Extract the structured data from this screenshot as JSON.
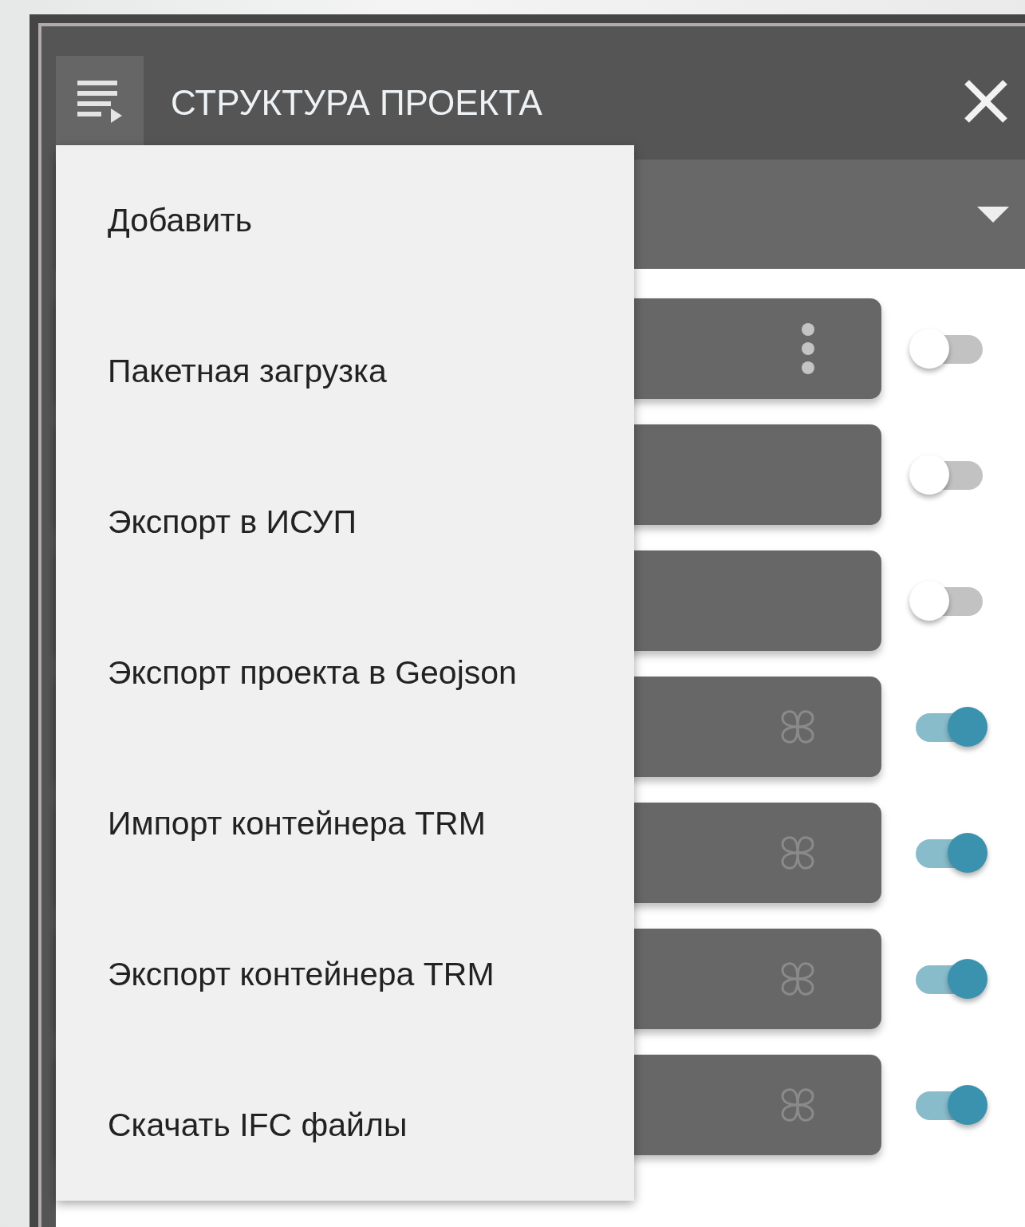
{
  "header": {
    "title": "СТРУКТУРА ПРОЕКТА"
  },
  "menu": {
    "items": [
      {
        "label": "Добавить"
      },
      {
        "label": "Пакетная загрузка"
      },
      {
        "label": "Экспорт в ИСУП"
      },
      {
        "label": "Экспорт проекта в Geojson"
      },
      {
        "label": "Импорт контейнера TRM"
      },
      {
        "label": "Экспорт контейнера TRM"
      },
      {
        "label": "Скачать IFC файлы"
      }
    ]
  },
  "layers": [
    {
      "kind": "dots",
      "on": false
    },
    {
      "kind": "blank",
      "on": false
    },
    {
      "kind": "blank",
      "on": false
    },
    {
      "kind": "clover",
      "on": true
    },
    {
      "kind": "clover",
      "on": true
    },
    {
      "kind": "clover",
      "on": true
    },
    {
      "kind": "clover",
      "on": true
    }
  ]
}
